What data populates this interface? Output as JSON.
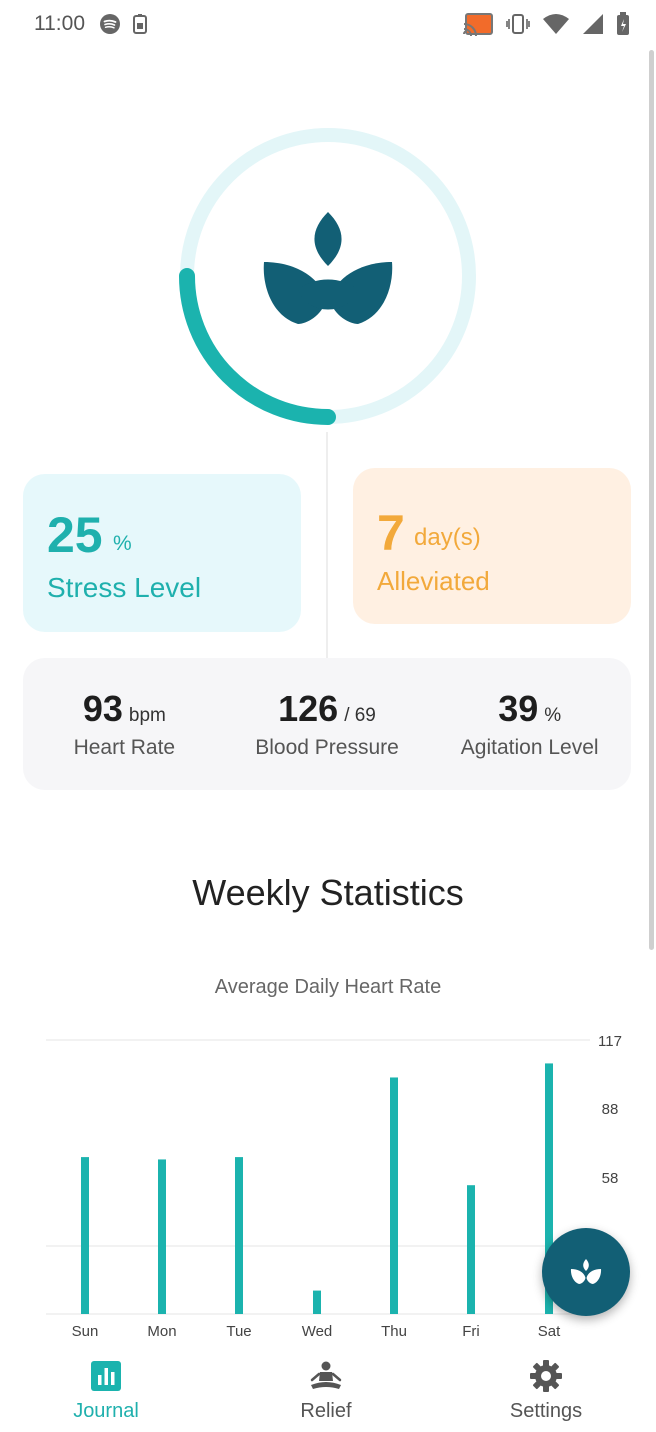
{
  "status_bar": {
    "time": "11:00",
    "icons_left": [
      "spotify-icon",
      "battery-saver-icon"
    ],
    "icons_right": [
      "cast-icon",
      "vibrate-icon",
      "wifi-icon",
      "signal-icon",
      "battery-icon"
    ]
  },
  "hero": {
    "progress_fraction": 0.25,
    "icon": "lotus-icon",
    "colors": {
      "ring_track": "#e3f6f8",
      "ring_progress": "#1bb3ae",
      "lotus": "#125f75"
    }
  },
  "stress": {
    "value": "25",
    "unit": "%",
    "label": "Stress Level"
  },
  "alleviated": {
    "value": "7",
    "unit": "day(s)",
    "label": "Alleviated"
  },
  "vitals": [
    {
      "value": "93",
      "unit": "bpm",
      "label": "Heart Rate"
    },
    {
      "value": "126",
      "unit": "/ 69",
      "label": "Blood Pressure"
    },
    {
      "value": "39",
      "unit": "%",
      "label": "Agitation Level"
    }
  ],
  "weekly": {
    "title": "Weekly Statistics",
    "chart_title": "Average Daily Heart Rate"
  },
  "chart_data": {
    "type": "bar",
    "title": "Average Daily Heart Rate",
    "categories": [
      "Sun",
      "Mon",
      "Tue",
      "Wed",
      "Thu",
      "Fri",
      "Sat"
    ],
    "values": [
      67,
      66,
      67,
      10,
      101,
      55,
      107
    ],
    "y_ticks": [
      "117",
      "88",
      "58"
    ],
    "ylim": [
      0,
      117
    ],
    "grid": true,
    "bar_color": "#1bb3ae"
  },
  "fab": {
    "icon": "lotus-icon"
  },
  "bottom_nav": [
    {
      "label": "Journal",
      "icon": "bar-chart-icon",
      "active": true
    },
    {
      "label": "Relief",
      "icon": "meditation-icon",
      "active": false
    },
    {
      "label": "Settings",
      "icon": "gear-icon",
      "active": false
    }
  ],
  "colors": {
    "accent": "#1bb3ae",
    "warm": "#f2a93b",
    "dark_teal": "#125f75"
  }
}
